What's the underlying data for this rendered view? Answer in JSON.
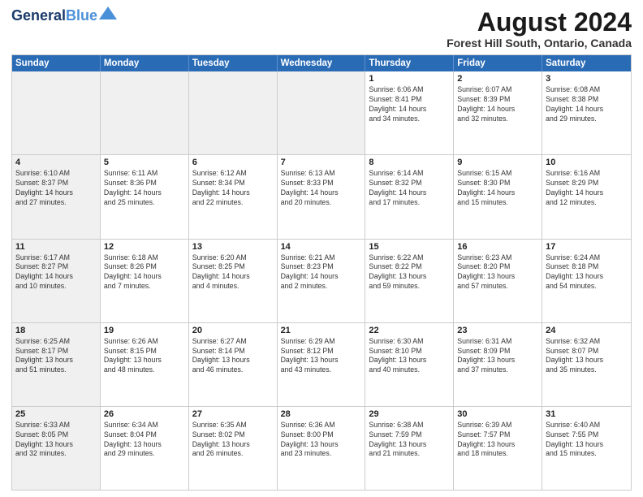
{
  "logo": {
    "line1": "General",
    "line2": "Blue"
  },
  "title": "August 2024",
  "subtitle": "Forest Hill South, Ontario, Canada",
  "headers": [
    "Sunday",
    "Monday",
    "Tuesday",
    "Wednesday",
    "Thursday",
    "Friday",
    "Saturday"
  ],
  "weeks": [
    [
      {
        "day": "",
        "info": "",
        "shaded": true
      },
      {
        "day": "",
        "info": "",
        "shaded": true
      },
      {
        "day": "",
        "info": "",
        "shaded": true
      },
      {
        "day": "",
        "info": "",
        "shaded": true
      },
      {
        "day": "1",
        "info": "Sunrise: 6:06 AM\nSunset: 8:41 PM\nDaylight: 14 hours\nand 34 minutes."
      },
      {
        "day": "2",
        "info": "Sunrise: 6:07 AM\nSunset: 8:39 PM\nDaylight: 14 hours\nand 32 minutes."
      },
      {
        "day": "3",
        "info": "Sunrise: 6:08 AM\nSunset: 8:38 PM\nDaylight: 14 hours\nand 29 minutes."
      }
    ],
    [
      {
        "day": "4",
        "info": "Sunrise: 6:10 AM\nSunset: 8:37 PM\nDaylight: 14 hours\nand 27 minutes.",
        "shaded": true
      },
      {
        "day": "5",
        "info": "Sunrise: 6:11 AM\nSunset: 8:36 PM\nDaylight: 14 hours\nand 25 minutes."
      },
      {
        "day": "6",
        "info": "Sunrise: 6:12 AM\nSunset: 8:34 PM\nDaylight: 14 hours\nand 22 minutes."
      },
      {
        "day": "7",
        "info": "Sunrise: 6:13 AM\nSunset: 8:33 PM\nDaylight: 14 hours\nand 20 minutes."
      },
      {
        "day": "8",
        "info": "Sunrise: 6:14 AM\nSunset: 8:32 PM\nDaylight: 14 hours\nand 17 minutes."
      },
      {
        "day": "9",
        "info": "Sunrise: 6:15 AM\nSunset: 8:30 PM\nDaylight: 14 hours\nand 15 minutes."
      },
      {
        "day": "10",
        "info": "Sunrise: 6:16 AM\nSunset: 8:29 PM\nDaylight: 14 hours\nand 12 minutes."
      }
    ],
    [
      {
        "day": "11",
        "info": "Sunrise: 6:17 AM\nSunset: 8:27 PM\nDaylight: 14 hours\nand 10 minutes.",
        "shaded": true
      },
      {
        "day": "12",
        "info": "Sunrise: 6:18 AM\nSunset: 8:26 PM\nDaylight: 14 hours\nand 7 minutes."
      },
      {
        "day": "13",
        "info": "Sunrise: 6:20 AM\nSunset: 8:25 PM\nDaylight: 14 hours\nand 4 minutes."
      },
      {
        "day": "14",
        "info": "Sunrise: 6:21 AM\nSunset: 8:23 PM\nDaylight: 14 hours\nand 2 minutes."
      },
      {
        "day": "15",
        "info": "Sunrise: 6:22 AM\nSunset: 8:22 PM\nDaylight: 13 hours\nand 59 minutes."
      },
      {
        "day": "16",
        "info": "Sunrise: 6:23 AM\nSunset: 8:20 PM\nDaylight: 13 hours\nand 57 minutes."
      },
      {
        "day": "17",
        "info": "Sunrise: 6:24 AM\nSunset: 8:18 PM\nDaylight: 13 hours\nand 54 minutes."
      }
    ],
    [
      {
        "day": "18",
        "info": "Sunrise: 6:25 AM\nSunset: 8:17 PM\nDaylight: 13 hours\nand 51 minutes.",
        "shaded": true
      },
      {
        "day": "19",
        "info": "Sunrise: 6:26 AM\nSunset: 8:15 PM\nDaylight: 13 hours\nand 48 minutes."
      },
      {
        "day": "20",
        "info": "Sunrise: 6:27 AM\nSunset: 8:14 PM\nDaylight: 13 hours\nand 46 minutes."
      },
      {
        "day": "21",
        "info": "Sunrise: 6:29 AM\nSunset: 8:12 PM\nDaylight: 13 hours\nand 43 minutes."
      },
      {
        "day": "22",
        "info": "Sunrise: 6:30 AM\nSunset: 8:10 PM\nDaylight: 13 hours\nand 40 minutes."
      },
      {
        "day": "23",
        "info": "Sunrise: 6:31 AM\nSunset: 8:09 PM\nDaylight: 13 hours\nand 37 minutes."
      },
      {
        "day": "24",
        "info": "Sunrise: 6:32 AM\nSunset: 8:07 PM\nDaylight: 13 hours\nand 35 minutes."
      }
    ],
    [
      {
        "day": "25",
        "info": "Sunrise: 6:33 AM\nSunset: 8:05 PM\nDaylight: 13 hours\nand 32 minutes.",
        "shaded": true
      },
      {
        "day": "26",
        "info": "Sunrise: 6:34 AM\nSunset: 8:04 PM\nDaylight: 13 hours\nand 29 minutes."
      },
      {
        "day": "27",
        "info": "Sunrise: 6:35 AM\nSunset: 8:02 PM\nDaylight: 13 hours\nand 26 minutes."
      },
      {
        "day": "28",
        "info": "Sunrise: 6:36 AM\nSunset: 8:00 PM\nDaylight: 13 hours\nand 23 minutes."
      },
      {
        "day": "29",
        "info": "Sunrise: 6:38 AM\nSunset: 7:59 PM\nDaylight: 13 hours\nand 21 minutes."
      },
      {
        "day": "30",
        "info": "Sunrise: 6:39 AM\nSunset: 7:57 PM\nDaylight: 13 hours\nand 18 minutes."
      },
      {
        "day": "31",
        "info": "Sunrise: 6:40 AM\nSunset: 7:55 PM\nDaylight: 13 hours\nand 15 minutes."
      }
    ]
  ]
}
